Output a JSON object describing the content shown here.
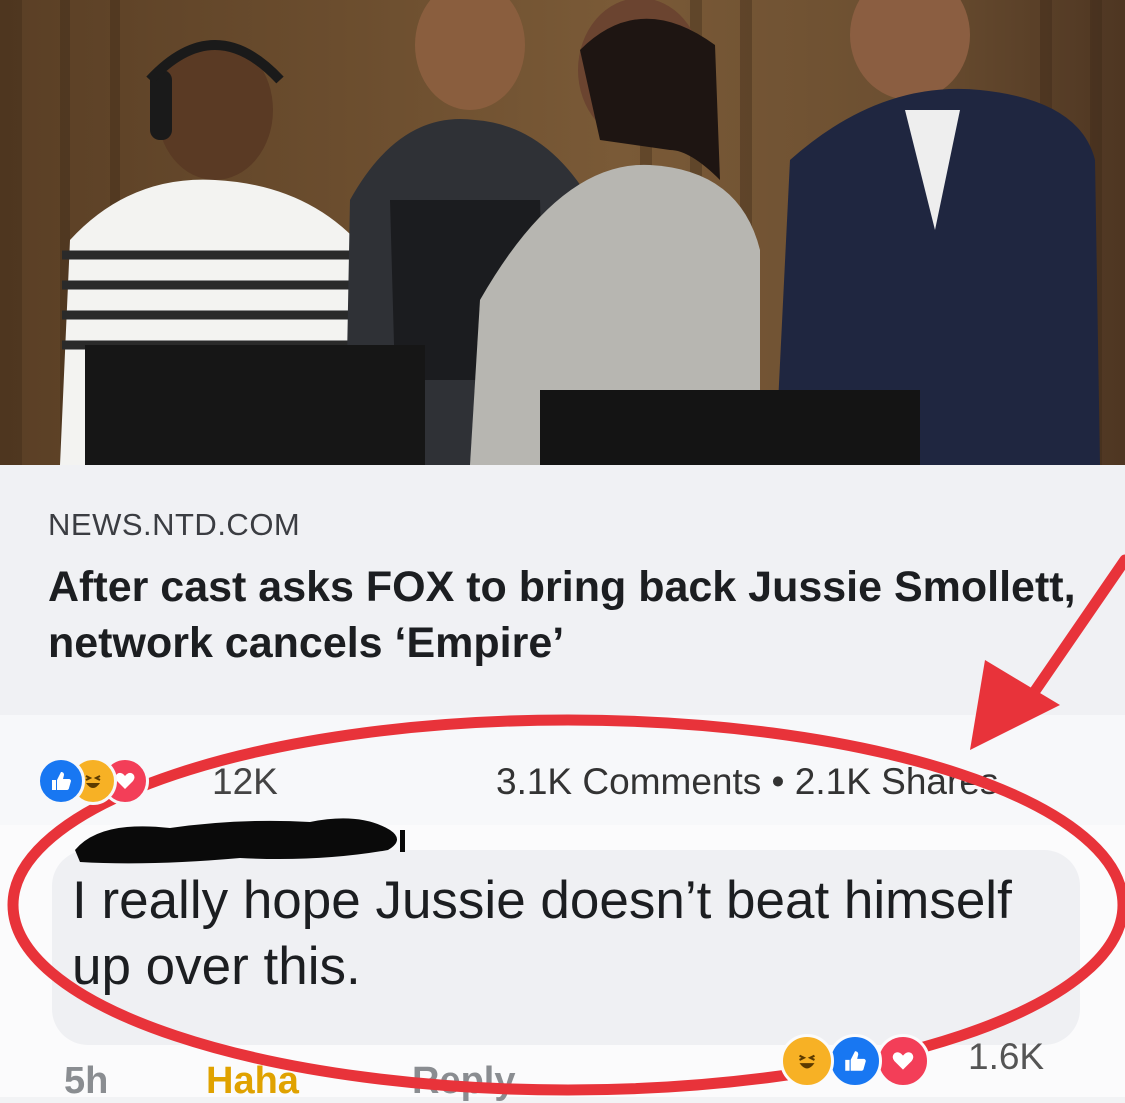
{
  "post": {
    "source": "NEWS.NTD.COM",
    "headline": "After cast asks FOX to bring back Jussie Smollett, network cancels ‘Empire’"
  },
  "stats": {
    "reaction_icons": [
      "like-icon",
      "haha-icon",
      "love-icon"
    ],
    "reaction_count": "12K",
    "comments_shares": "3.1K Comments • 2.1K Shares"
  },
  "comment": {
    "text": "I really hope Jussie doesn’t beat himself up over this.",
    "time": "5h",
    "haha_label": "Haha",
    "reply_label": "Reply",
    "reaction_icons": [
      "haha-icon",
      "like-icon",
      "love-icon"
    ],
    "reaction_count": "1.6K"
  },
  "colors": {
    "like_blue": "#1877f2",
    "love_red": "#f33e58",
    "haha_yellow": "#f7b125",
    "annotation_red": "#e8333a"
  }
}
